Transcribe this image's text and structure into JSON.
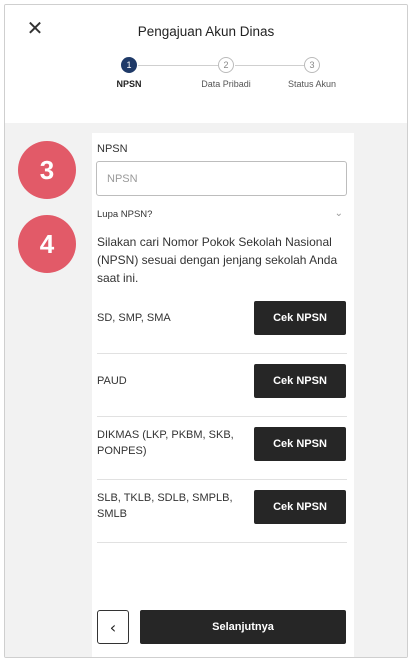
{
  "header": {
    "title": "Pengajuan Akun Dinas",
    "close_icon": "close-icon"
  },
  "stepper": {
    "steps": [
      {
        "number": "1",
        "label": "NPSN",
        "active": true
      },
      {
        "number": "2",
        "label": "Data Pribadi",
        "active": false
      },
      {
        "number": "3",
        "label": "Status Akun",
        "active": false
      }
    ]
  },
  "form": {
    "npsn_label": "NPSN",
    "npsn_placeholder": "NPSN",
    "npsn_value": "",
    "forgot_label": "Lupa NPSN?",
    "info_text": "Silakan cari Nomor Pokok Sekolah Nasional (NPSN) sesuai dengan jenjang sekolah Anda saat ini."
  },
  "levels": [
    {
      "name": "SD, SMP, SMA",
      "button": "Cek NPSN"
    },
    {
      "name": "PAUD",
      "button": "Cek NPSN"
    },
    {
      "name": "DIKMAS (LKP, PKBM, SKB, PONPES)",
      "button": "Cek NPSN"
    },
    {
      "name": "SLB, TKLB, SDLB, SMPLB, SMLB",
      "button": "Cek NPSN"
    }
  ],
  "footer": {
    "back_icon": "chevron-left-icon",
    "next_label": "Selanjutnya"
  },
  "annotations": {
    "badge_a": "3",
    "badge_b": "4"
  },
  "colors": {
    "step_active": "#1f3a68",
    "button_dark": "#262626",
    "badge": "#e25a68",
    "content_bg": "#f2f2f2"
  }
}
